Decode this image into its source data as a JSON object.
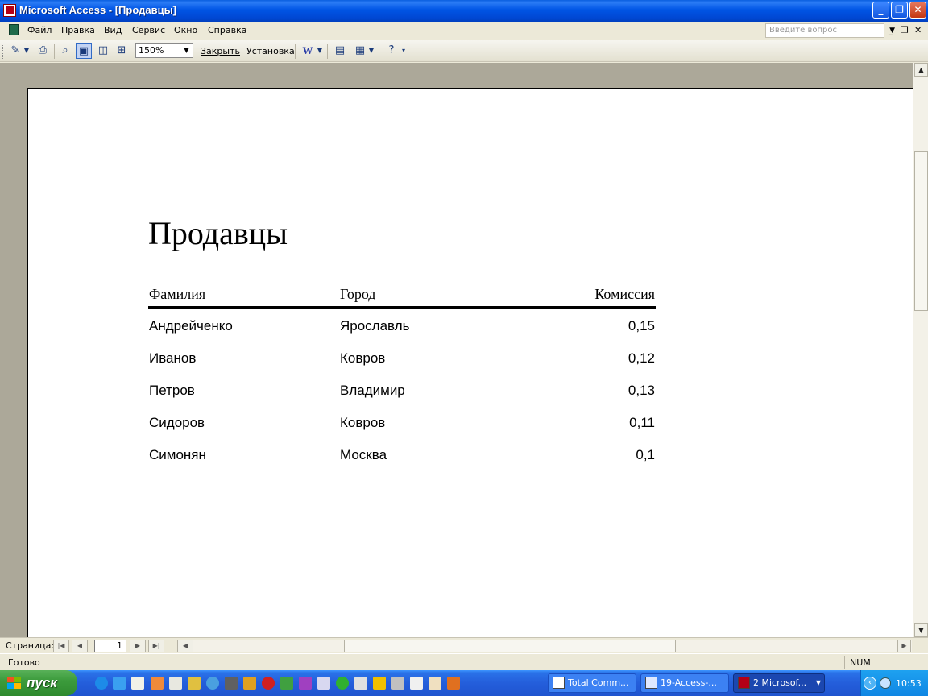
{
  "window": {
    "title": "Microsoft Access - [Продавцы]",
    "buttons": {
      "minimize": "_",
      "restore": "❐",
      "close": "✕"
    }
  },
  "menu": {
    "items": [
      {
        "label": "Файл"
      },
      {
        "label": "Правка"
      },
      {
        "label": "Вид"
      },
      {
        "label": "Сервис"
      },
      {
        "label": "Окно"
      },
      {
        "label": "Справка"
      }
    ],
    "help_placeholder": "Введите вопрос"
  },
  "toolbar": {
    "zoom": "150%",
    "close_label": "Закрыть",
    "setup_label": "Установка"
  },
  "report": {
    "title": "Продавцы",
    "columns": [
      "Фамилия",
      "Город",
      "Комиссия"
    ],
    "rows": [
      [
        "Андрейченко",
        "Ярославль",
        "0,15"
      ],
      [
        "Иванов",
        "Ковров",
        "0,12"
      ],
      [
        "Петров",
        "Владимир",
        "0,13"
      ],
      [
        "Сидоров",
        "Ковров",
        "0,11"
      ],
      [
        "Симонян",
        "Москва",
        "0,1"
      ]
    ]
  },
  "navigation": {
    "page_label": "Страница:",
    "page_number": "1"
  },
  "status": {
    "text": "Готово",
    "num_indicator": "NUM"
  },
  "taskbar": {
    "start_label": "пуск",
    "tasks": [
      {
        "label": "Total Comm...",
        "active": false
      },
      {
        "label": "19-Access-...",
        "active": false
      },
      {
        "label": "2 Microsof...",
        "active": true
      }
    ],
    "clock": "10:53"
  },
  "colors": {
    "titlebar": "#0055e5",
    "workspace": "#aca899",
    "taskbar": "#245edb",
    "start_button": "#3c9b3c"
  }
}
